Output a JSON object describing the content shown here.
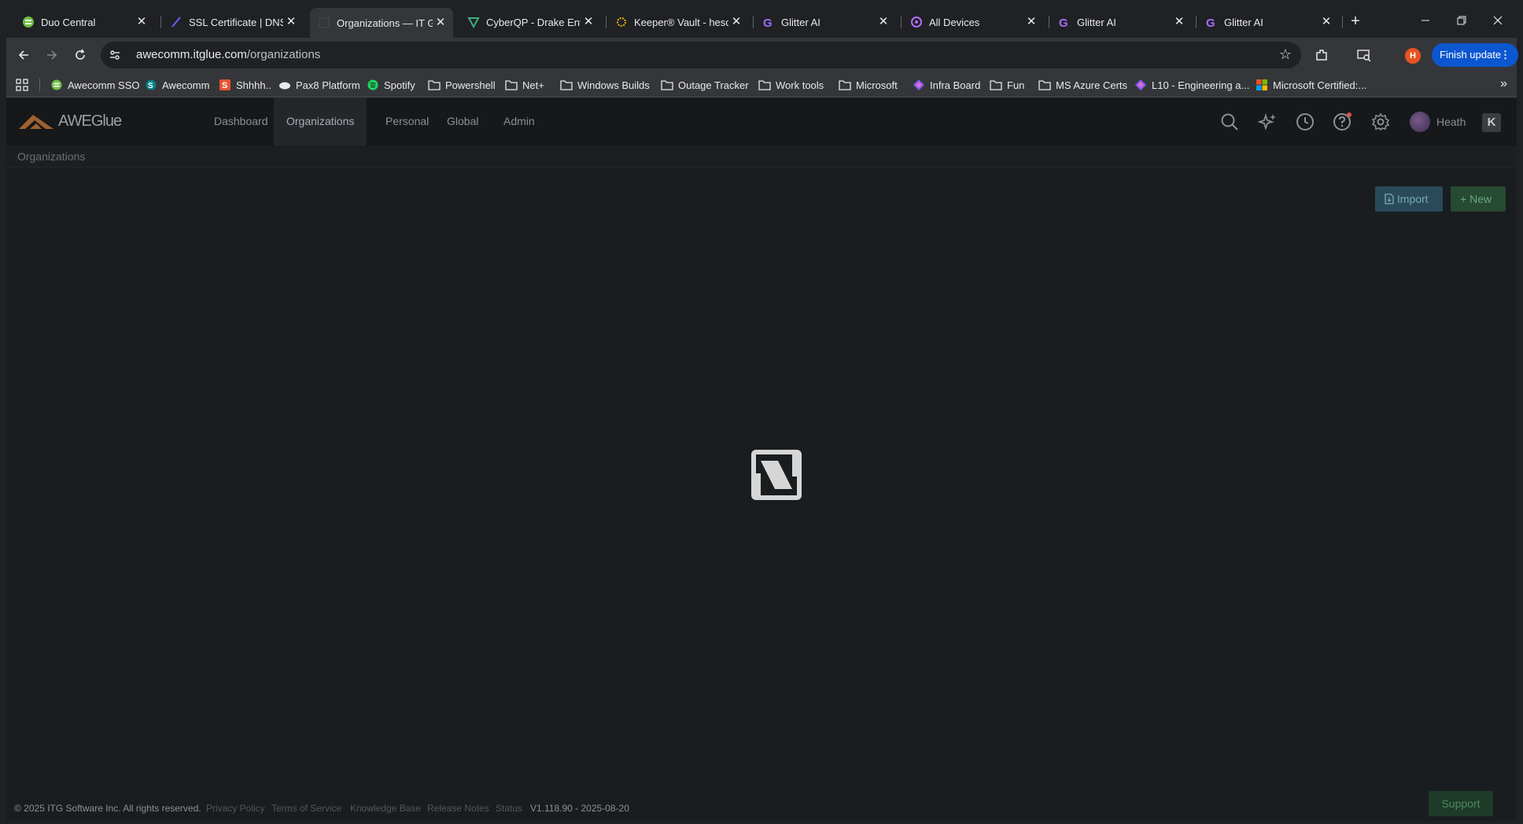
{
  "tabs": [
    {
      "title": "Duo Central",
      "icon": "duo-icon",
      "active": false
    },
    {
      "title": "SSL Certificate | DNSFilter",
      "icon": "dnsfilter-icon",
      "active": false
    },
    {
      "title": "Organizations — IT Glue",
      "icon": "itglue-icon",
      "active": true
    },
    {
      "title": "CyberQP - Drake Enterprises",
      "icon": "cyberqp-icon",
      "active": false
    },
    {
      "title": "Keeper® Vault - heschen",
      "icon": "keeper-icon",
      "active": false
    },
    {
      "title": "Glitter AI",
      "icon": "glitter-icon",
      "active": false
    },
    {
      "title": "All Devices",
      "icon": "devices-icon",
      "active": false
    },
    {
      "title": "Glitter AI",
      "icon": "glitter-icon",
      "active": false
    },
    {
      "title": "Glitter AI",
      "icon": "glitter-icon",
      "active": false
    }
  ],
  "toolbar": {
    "url_host": "awecomm.itglue.com",
    "url_path": "/organizations",
    "profile_initial": "H",
    "finish_update": "Finish update"
  },
  "bookmarks": [
    {
      "label": "Awecomm SSO",
      "icon": "awecomm-sso-icon"
    },
    {
      "label": "Awecomm",
      "icon": "sharepoint-icon"
    },
    {
      "label": "Shhhh..",
      "icon": "s-brand-icon"
    },
    {
      "label": "Pax8 Platform",
      "icon": "cloud-icon"
    },
    {
      "label": "Spotify",
      "icon": "spotify-icon"
    },
    {
      "label": "Powershell",
      "icon": "folder-icon"
    },
    {
      "label": "Net+",
      "icon": "folder-icon"
    },
    {
      "label": "Windows Builds",
      "icon": "folder-icon"
    },
    {
      "label": "Outage Tracker",
      "icon": "folder-icon"
    },
    {
      "label": "Work tools",
      "icon": "folder-icon"
    },
    {
      "label": "Microsoft",
      "icon": "folder-icon"
    },
    {
      "label": "Infra Board",
      "icon": "loop-icon"
    },
    {
      "label": "Fun",
      "icon": "folder-icon"
    },
    {
      "label": "MS Azure Certs",
      "icon": "folder-icon"
    },
    {
      "label": "L10 - Engineering a...",
      "icon": "loop-icon"
    },
    {
      "label": "Microsoft Certified:...",
      "icon": "microsoft-icon"
    }
  ],
  "app": {
    "logo_text": "AWEGlue",
    "nav": [
      "Dashboard",
      "Organizations",
      "Personal",
      "Global",
      "Admin"
    ],
    "active_nav": "Organizations",
    "user_name": "Heath",
    "kaseya_glyph": "K",
    "breadcrumb": "Organizations",
    "import_label": "Import",
    "new_label": "New",
    "support_label": "Support"
  },
  "footer": {
    "copyright": "© 2025 ITG Software Inc. All rights reserved.",
    "links": [
      "Privacy Policy",
      "Terms of Service",
      "Knowledge Base",
      "Release Notes",
      "Status"
    ],
    "version": "V1.118.90 - 2025-08-20"
  },
  "colors": {
    "accent_blue": "#0b57d0",
    "import_bg": "#2a4a5a",
    "new_bg": "#264a32",
    "profile": "#e8531f"
  }
}
